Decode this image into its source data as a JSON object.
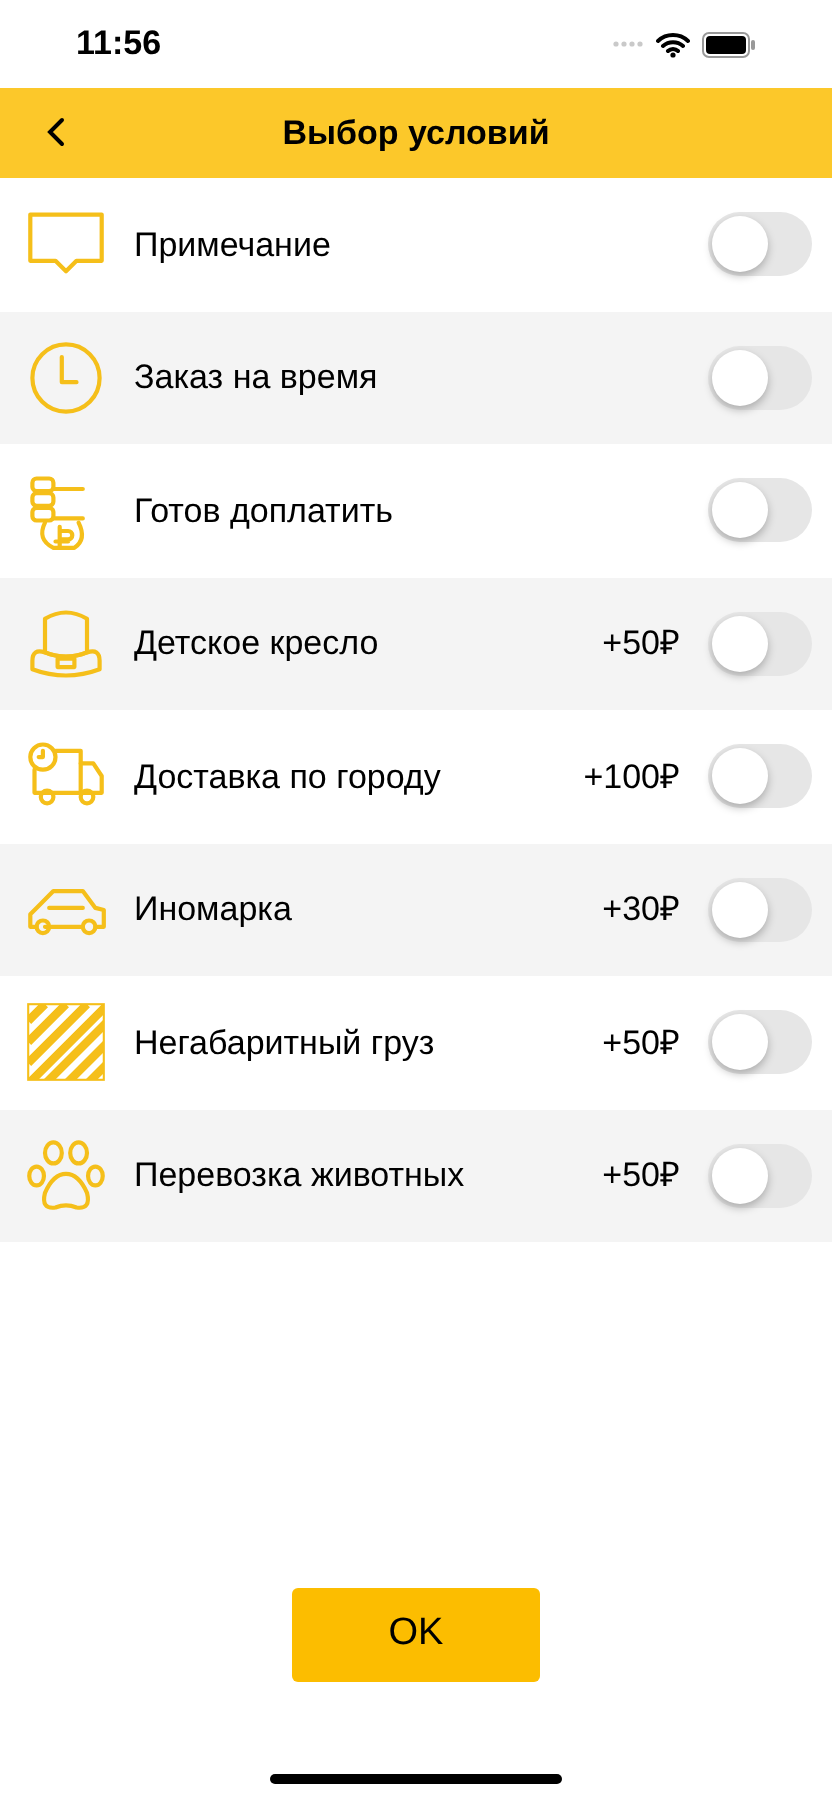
{
  "status_bar": {
    "time": "11:56"
  },
  "header": {
    "title": "Выбор условий"
  },
  "options": [
    {
      "label": "Примечание",
      "on": false
    },
    {
      "label": "Заказ на время",
      "on": false
    },
    {
      "label": "Готов доплатить",
      "on": false
    },
    {
      "label": "Детское кресло",
      "price": "+50₽",
      "on": false
    },
    {
      "label": "Доставка по городу",
      "price": "+100₽",
      "on": false
    },
    {
      "label": "Иномарка",
      "price": "+30₽",
      "on": false
    },
    {
      "label": "Негабаритный груз",
      "price": "+50₽",
      "on": false
    },
    {
      "label": "Перевозка животных",
      "price": "+50₽",
      "on": false
    }
  ],
  "ok_button": "OK"
}
